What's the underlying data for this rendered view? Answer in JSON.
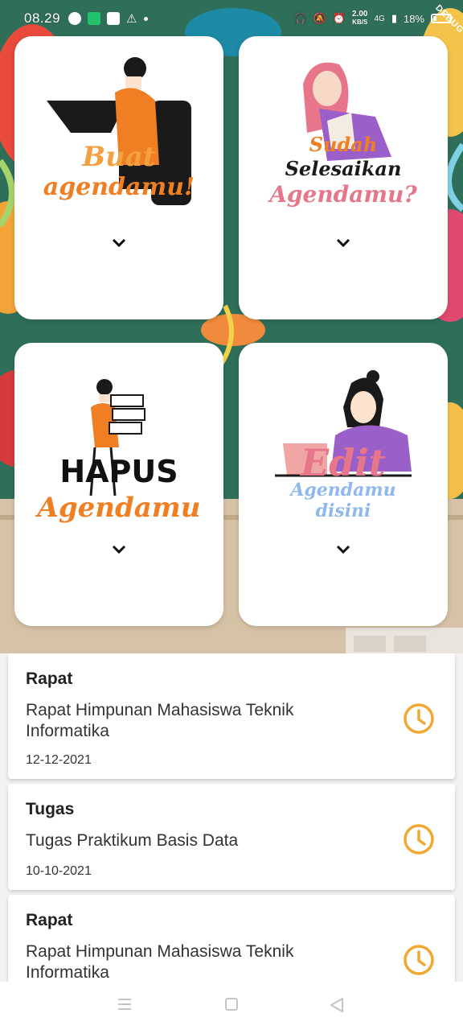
{
  "status_bar": {
    "time": "08.29",
    "net_speed": "2.00",
    "net_unit": "KB/S",
    "signal_label": "4G",
    "battery": "18%",
    "debug_label": "DEBUG"
  },
  "cards": [
    {
      "label_line1": "Buat",
      "label_line2": "agendamu!"
    },
    {
      "label_line1": "Sudah",
      "label_line2": "Selesaikan",
      "label_line3": "Agendamu?"
    },
    {
      "label_line1": "HAPUS",
      "label_line2": "Agendamu"
    },
    {
      "label_line1": "Edit",
      "label_line2": "Agendamu",
      "label_line3": "disini"
    }
  ],
  "agenda": [
    {
      "title": "Rapat",
      "description": "Rapat Himpunan Mahasiswa Teknik Informatika",
      "date": "12-12-2021"
    },
    {
      "title": "Tugas",
      "description": "Tugas Praktikum Basis Data",
      "date": "10-10-2021"
    },
    {
      "title": "Rapat",
      "description": "Rapat Himpunan Mahasiswa Teknik Informatika",
      "date": ""
    }
  ],
  "colors": {
    "accent_clock": "#f0a832",
    "card_bg": "#ffffff",
    "orange": "#f07e22",
    "pink": "#e8768a",
    "purple": "#9b5fc9",
    "blue": "#8fb8ec"
  },
  "icons": {
    "chevron": "chevron-down-icon",
    "clock": "clock-icon",
    "nav_menu": "menu-icon",
    "nav_home": "home-icon",
    "nav_back": "back-icon"
  }
}
